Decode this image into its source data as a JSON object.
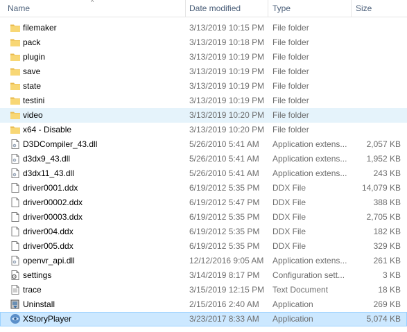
{
  "columns": {
    "name": "Name",
    "date": "Date modified",
    "type": "Type",
    "size": "Size"
  },
  "files": [
    {
      "name": "filemaker",
      "date": "3/13/2019 10:15 PM",
      "type": "File folder",
      "size": "",
      "icon": "folder-icon"
    },
    {
      "name": "pack",
      "date": "3/13/2019 10:18 PM",
      "type": "File folder",
      "size": "",
      "icon": "folder-icon"
    },
    {
      "name": "plugin",
      "date": "3/13/2019 10:19 PM",
      "type": "File folder",
      "size": "",
      "icon": "folder-icon"
    },
    {
      "name": "save",
      "date": "3/13/2019 10:19 PM",
      "type": "File folder",
      "size": "",
      "icon": "folder-icon"
    },
    {
      "name": "state",
      "date": "3/13/2019 10:19 PM",
      "type": "File folder",
      "size": "",
      "icon": "folder-icon"
    },
    {
      "name": "testini",
      "date": "3/13/2019 10:19 PM",
      "type": "File folder",
      "size": "",
      "icon": "folder-icon"
    },
    {
      "name": "video",
      "date": "3/13/2019 10:20 PM",
      "type": "File folder",
      "size": "",
      "icon": "folder-icon",
      "state": "hover"
    },
    {
      "name": "x64 - Disable",
      "date": "3/13/2019 10:20 PM",
      "type": "File folder",
      "size": "",
      "icon": "folder-icon"
    },
    {
      "name": "D3DCompiler_43.dll",
      "date": "5/26/2010 5:41 AM",
      "type": "Application extens...",
      "size": "2,057 KB",
      "icon": "dll-file-icon"
    },
    {
      "name": "d3dx9_43.dll",
      "date": "5/26/2010 5:41 AM",
      "type": "Application extens...",
      "size": "1,952 KB",
      "icon": "dll-file-icon"
    },
    {
      "name": "d3dx11_43.dll",
      "date": "5/26/2010 5:41 AM",
      "type": "Application extens...",
      "size": "243 KB",
      "icon": "dll-file-icon"
    },
    {
      "name": "driver0001.ddx",
      "date": "6/19/2012 5:35 PM",
      "type": "DDX File",
      "size": "14,079 KB",
      "icon": "blank-file-icon"
    },
    {
      "name": "driver00002.ddx",
      "date": "6/19/2012 5:47 PM",
      "type": "DDX File",
      "size": "388 KB",
      "icon": "blank-file-icon"
    },
    {
      "name": "driver00003.ddx",
      "date": "6/19/2012 5:35 PM",
      "type": "DDX File",
      "size": "2,705 KB",
      "icon": "blank-file-icon"
    },
    {
      "name": "driver004.ddx",
      "date": "6/19/2012 5:35 PM",
      "type": "DDX File",
      "size": "182 KB",
      "icon": "blank-file-icon"
    },
    {
      "name": "driver005.ddx",
      "date": "6/19/2012 5:35 PM",
      "type": "DDX File",
      "size": "329 KB",
      "icon": "blank-file-icon"
    },
    {
      "name": "openvr_api.dll",
      "date": "12/12/2016 9:05 AM",
      "type": "Application extens...",
      "size": "261 KB",
      "icon": "dll-file-icon"
    },
    {
      "name": "settings",
      "date": "3/14/2019 8:17 PM",
      "type": "Configuration sett...",
      "size": "3 KB",
      "icon": "settings-file-icon"
    },
    {
      "name": "trace",
      "date": "3/15/2019 12:15 PM",
      "type": "Text Document",
      "size": "18 KB",
      "icon": "text-file-icon"
    },
    {
      "name": "Uninstall",
      "date": "2/15/2016 2:40 AM",
      "type": "Application",
      "size": "269 KB",
      "icon": "uninstall-app-icon"
    },
    {
      "name": "XStoryPlayer",
      "date": "3/23/2017 8:33 AM",
      "type": "Application",
      "size": "5,074 KB",
      "icon": "xstoryplayer-app-icon",
      "state": "selected"
    }
  ],
  "colors": {
    "folder": "#f8d775",
    "hover": "#e5f3fb",
    "selected": "#cce8ff",
    "header_text": "#4c607a"
  }
}
